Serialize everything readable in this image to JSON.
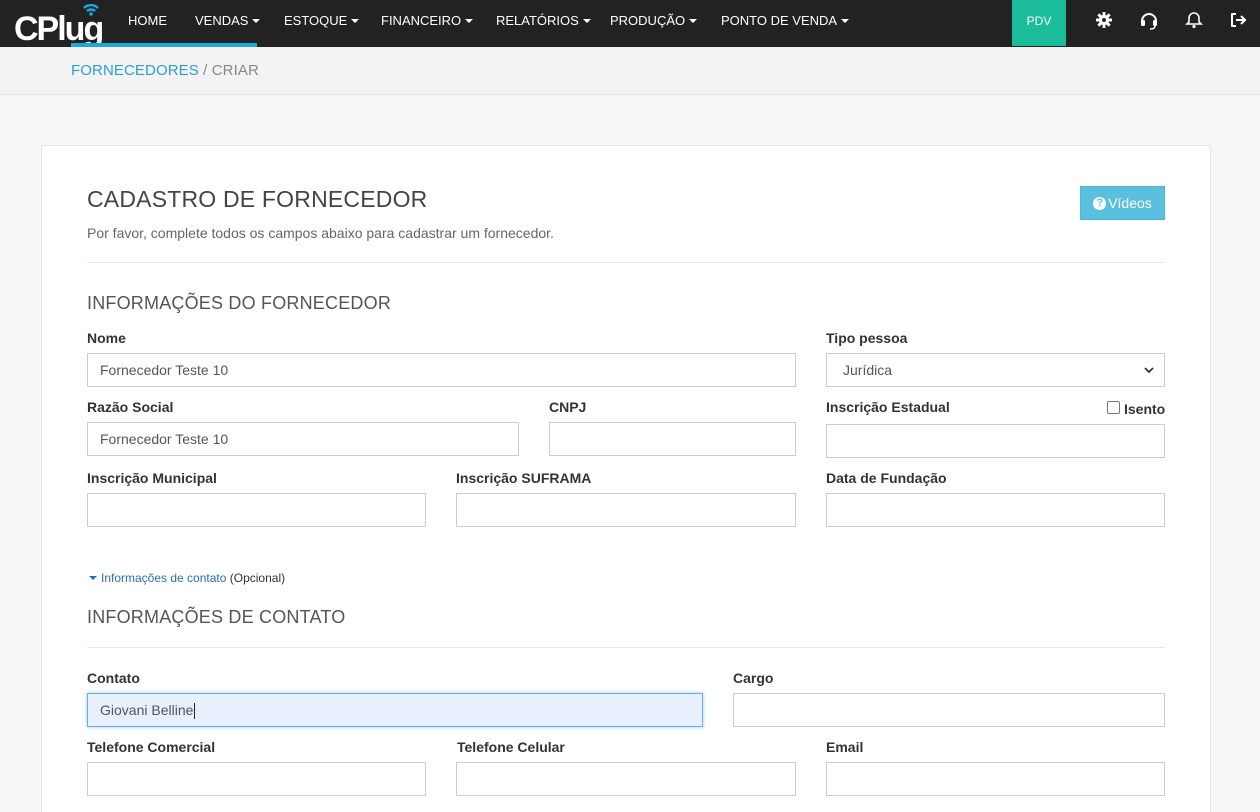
{
  "nav": {
    "brand": "CPlug",
    "items": [
      {
        "label": "HOME",
        "caret": false
      },
      {
        "label": "VENDAS",
        "caret": true
      },
      {
        "label": "ESTOQUE",
        "caret": true
      },
      {
        "label": "FINANCEIRO",
        "caret": true
      },
      {
        "label": "RELATÓRIOS",
        "caret": true
      },
      {
        "label": "PRODUÇÃO",
        "caret": true
      },
      {
        "label": "PONTO DE VENDA",
        "caret": true
      }
    ],
    "pdv_label": "PDV",
    "icons": [
      "gear-icon",
      "headset-icon",
      "bell-icon",
      "logout-icon"
    ],
    "colors": {
      "bar": "#222222",
      "pdv": "#1abc9c",
      "brand": "#1ea6e0"
    }
  },
  "breadcrumb": {
    "parent": "FORNECEDORES",
    "separator": "/",
    "current": "CRIAR"
  },
  "page": {
    "title": "CADASTRO DE FORNECEDOR",
    "subtitle": "Por favor, complete todos os campos abaixo para cadastrar um fornecedor.",
    "videos_label": "Vídeos"
  },
  "supplier_section": {
    "title": "INFORMAÇÕES DO FORNECEDOR",
    "nome": {
      "label": "Nome",
      "value": "Fornecedor Teste 10"
    },
    "tipo_pessoa": {
      "label": "Tipo pessoa",
      "selected": "Jurídica"
    },
    "razao_social": {
      "label": "Razão Social",
      "value": "Fornecedor Teste 10"
    },
    "cnpj": {
      "label": "CNPJ",
      "value": ""
    },
    "inscricao_estadual": {
      "label": "Inscrição Estadual",
      "value": ""
    },
    "isento": {
      "label": "Isento",
      "checked": false
    },
    "inscricao_municipal": {
      "label": "Inscrição Municipal",
      "value": ""
    },
    "inscricao_suframa": {
      "label": "Inscrição SUFRAMA",
      "value": ""
    },
    "data_fundacao": {
      "label": "Data de Fundação",
      "value": ""
    }
  },
  "contact_toggle": {
    "link": "Informações de contato",
    "optional": "(Opcional)"
  },
  "contact_section": {
    "title": "INFORMAÇÕES DE CONTATO",
    "contato": {
      "label": "Contato",
      "value": "Giovani Belline"
    },
    "cargo": {
      "label": "Cargo",
      "value": ""
    },
    "telefone_comercial": {
      "label": "Telefone Comercial",
      "value": ""
    },
    "telefone_celular": {
      "label": "Telefone Celular",
      "value": ""
    },
    "email": {
      "label": "Email",
      "value": ""
    }
  }
}
